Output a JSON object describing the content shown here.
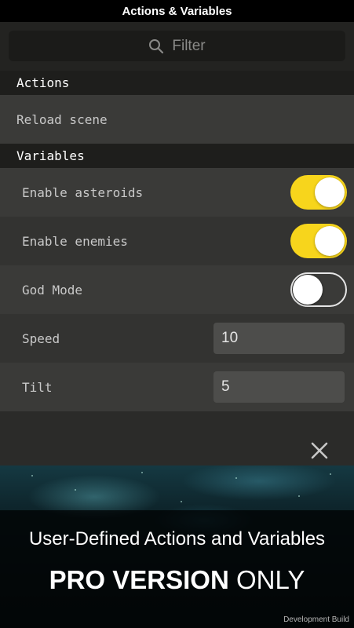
{
  "title": "Actions & Variables",
  "filter": {
    "placeholder": "Filter"
  },
  "sections": {
    "actions": "Actions",
    "variables": "Variables"
  },
  "actions": [
    {
      "label": "Reload scene"
    }
  ],
  "variables": [
    {
      "label": "Enable asteroids",
      "type": "toggle",
      "value": true
    },
    {
      "label": "Enable enemies",
      "type": "toggle",
      "value": true
    },
    {
      "label": "God Mode",
      "type": "toggle",
      "value": false
    },
    {
      "label": "Speed",
      "type": "number",
      "value": "10"
    },
    {
      "label": "Tilt",
      "type": "number",
      "value": "5"
    }
  ],
  "promo": {
    "subtitle": "User-Defined Actions and Variables",
    "headline_bold": "PRO VERSION",
    "headline_rest": " ONLY",
    "footer": "Development Build"
  },
  "colors": {
    "accent": "#f7d51c"
  },
  "icons": {
    "search": "search-icon",
    "close": "close-icon"
  }
}
